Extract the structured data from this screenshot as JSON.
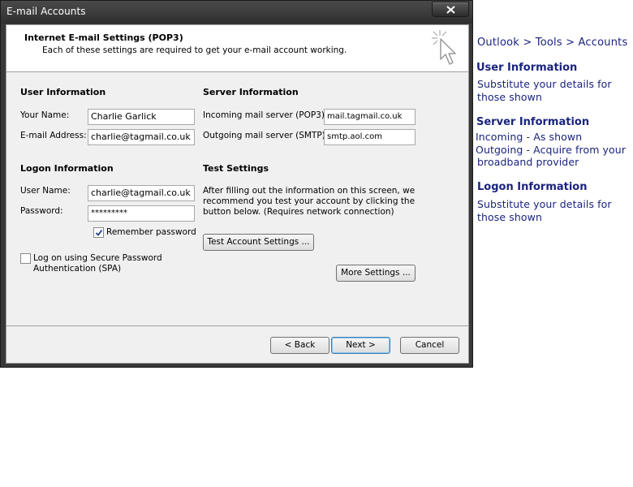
{
  "window": {
    "title": "E-mail Accounts",
    "header_title": "Internet E-mail Settings (POP3)",
    "header_subtitle": "Each of these settings are required to get your e-mail account working."
  },
  "user_info": {
    "title": "User Information",
    "name_label": "Your Name:",
    "name_value": "Charlie Garlick",
    "email_label": "E-mail Address:",
    "email_value": "charlie@tagmail.co.uk"
  },
  "server_info": {
    "title": "Server Information",
    "incoming_label": "Incoming mail server (POP3):",
    "incoming_value": "mail.tagmail.co.uk",
    "outgoing_label": "Outgoing mail server (SMTP):",
    "outgoing_value": "smtp.aol.com"
  },
  "logon_info": {
    "title": "Logon Information",
    "username_label": "User Name:",
    "username_value": "charlie@tagmail.co.uk",
    "password_label": "Password:",
    "password_value": "*********",
    "remember_label": "Remember password",
    "remember_checked": true,
    "spa_label_line1": "Log on using Secure Password",
    "spa_label_line2": "Authentication (SPA)",
    "spa_checked": false
  },
  "test_settings": {
    "title": "Test Settings",
    "desc_line1": "After filling out the information on this screen, we",
    "desc_line2": "recommend you test your account by clicking the",
    "desc_line3": "button below. (Requires network connection)",
    "test_button": "Test Account Settings ..."
  },
  "buttons": {
    "more_settings": "More Settings ...",
    "back": "< Back",
    "next": "Next >",
    "cancel": "Cancel"
  },
  "notes": {
    "path": "Outlook > Tools > Accounts",
    "user_title": "User Information",
    "user_line1": "Substitute your details for",
    "user_line2": "those shown",
    "server_title": "Server Information",
    "server_line1": "Incoming - As shown",
    "server_line2": "Outgoing - Acquire from your",
    "server_line3": "broadband provider",
    "logon_title": "Logon Information",
    "logon_line1": "Substitute your details for",
    "logon_line2": "those shown"
  },
  "icons": {
    "close": "close-icon",
    "wizard": "wizard-cursor-icon",
    "check": "checkmark-icon"
  }
}
